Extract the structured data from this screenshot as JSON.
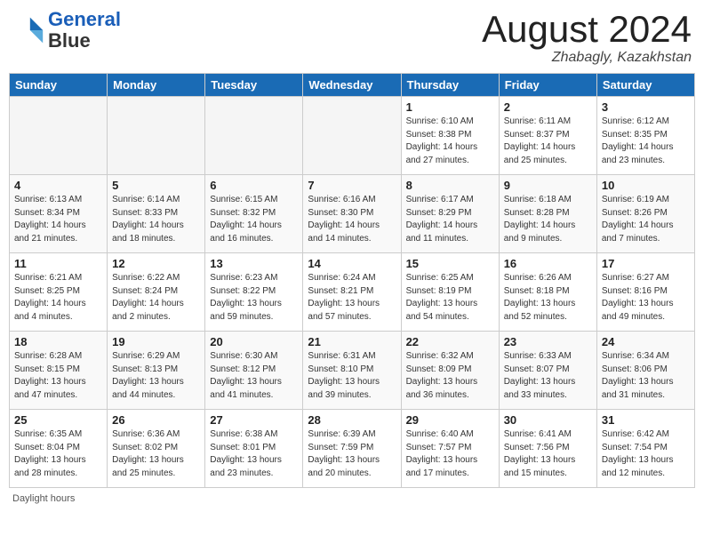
{
  "logo": {
    "line1": "General",
    "line2": "Blue"
  },
  "calendar": {
    "title": "August 2024",
    "subtitle": "Zhabagly, Kazakhstan"
  },
  "days_of_week": [
    "Sunday",
    "Monday",
    "Tuesday",
    "Wednesday",
    "Thursday",
    "Friday",
    "Saturday"
  ],
  "footer": "Daylight hours",
  "weeks": [
    [
      {
        "day": "",
        "info": ""
      },
      {
        "day": "",
        "info": ""
      },
      {
        "day": "",
        "info": ""
      },
      {
        "day": "",
        "info": ""
      },
      {
        "day": "1",
        "info": "Sunrise: 6:10 AM\nSunset: 8:38 PM\nDaylight: 14 hours\nand 27 minutes."
      },
      {
        "day": "2",
        "info": "Sunrise: 6:11 AM\nSunset: 8:37 PM\nDaylight: 14 hours\nand 25 minutes."
      },
      {
        "day": "3",
        "info": "Sunrise: 6:12 AM\nSunset: 8:35 PM\nDaylight: 14 hours\nand 23 minutes."
      }
    ],
    [
      {
        "day": "4",
        "info": "Sunrise: 6:13 AM\nSunset: 8:34 PM\nDaylight: 14 hours\nand 21 minutes."
      },
      {
        "day": "5",
        "info": "Sunrise: 6:14 AM\nSunset: 8:33 PM\nDaylight: 14 hours\nand 18 minutes."
      },
      {
        "day": "6",
        "info": "Sunrise: 6:15 AM\nSunset: 8:32 PM\nDaylight: 14 hours\nand 16 minutes."
      },
      {
        "day": "7",
        "info": "Sunrise: 6:16 AM\nSunset: 8:30 PM\nDaylight: 14 hours\nand 14 minutes."
      },
      {
        "day": "8",
        "info": "Sunrise: 6:17 AM\nSunset: 8:29 PM\nDaylight: 14 hours\nand 11 minutes."
      },
      {
        "day": "9",
        "info": "Sunrise: 6:18 AM\nSunset: 8:28 PM\nDaylight: 14 hours\nand 9 minutes."
      },
      {
        "day": "10",
        "info": "Sunrise: 6:19 AM\nSunset: 8:26 PM\nDaylight: 14 hours\nand 7 minutes."
      }
    ],
    [
      {
        "day": "11",
        "info": "Sunrise: 6:21 AM\nSunset: 8:25 PM\nDaylight: 14 hours\nand 4 minutes."
      },
      {
        "day": "12",
        "info": "Sunrise: 6:22 AM\nSunset: 8:24 PM\nDaylight: 14 hours\nand 2 minutes."
      },
      {
        "day": "13",
        "info": "Sunrise: 6:23 AM\nSunset: 8:22 PM\nDaylight: 13 hours\nand 59 minutes."
      },
      {
        "day": "14",
        "info": "Sunrise: 6:24 AM\nSunset: 8:21 PM\nDaylight: 13 hours\nand 57 minutes."
      },
      {
        "day": "15",
        "info": "Sunrise: 6:25 AM\nSunset: 8:19 PM\nDaylight: 13 hours\nand 54 minutes."
      },
      {
        "day": "16",
        "info": "Sunrise: 6:26 AM\nSunset: 8:18 PM\nDaylight: 13 hours\nand 52 minutes."
      },
      {
        "day": "17",
        "info": "Sunrise: 6:27 AM\nSunset: 8:16 PM\nDaylight: 13 hours\nand 49 minutes."
      }
    ],
    [
      {
        "day": "18",
        "info": "Sunrise: 6:28 AM\nSunset: 8:15 PM\nDaylight: 13 hours\nand 47 minutes."
      },
      {
        "day": "19",
        "info": "Sunrise: 6:29 AM\nSunset: 8:13 PM\nDaylight: 13 hours\nand 44 minutes."
      },
      {
        "day": "20",
        "info": "Sunrise: 6:30 AM\nSunset: 8:12 PM\nDaylight: 13 hours\nand 41 minutes."
      },
      {
        "day": "21",
        "info": "Sunrise: 6:31 AM\nSunset: 8:10 PM\nDaylight: 13 hours\nand 39 minutes."
      },
      {
        "day": "22",
        "info": "Sunrise: 6:32 AM\nSunset: 8:09 PM\nDaylight: 13 hours\nand 36 minutes."
      },
      {
        "day": "23",
        "info": "Sunrise: 6:33 AM\nSunset: 8:07 PM\nDaylight: 13 hours\nand 33 minutes."
      },
      {
        "day": "24",
        "info": "Sunrise: 6:34 AM\nSunset: 8:06 PM\nDaylight: 13 hours\nand 31 minutes."
      }
    ],
    [
      {
        "day": "25",
        "info": "Sunrise: 6:35 AM\nSunset: 8:04 PM\nDaylight: 13 hours\nand 28 minutes."
      },
      {
        "day": "26",
        "info": "Sunrise: 6:36 AM\nSunset: 8:02 PM\nDaylight: 13 hours\nand 25 minutes."
      },
      {
        "day": "27",
        "info": "Sunrise: 6:38 AM\nSunset: 8:01 PM\nDaylight: 13 hours\nand 23 minutes."
      },
      {
        "day": "28",
        "info": "Sunrise: 6:39 AM\nSunset: 7:59 PM\nDaylight: 13 hours\nand 20 minutes."
      },
      {
        "day": "29",
        "info": "Sunrise: 6:40 AM\nSunset: 7:57 PM\nDaylight: 13 hours\nand 17 minutes."
      },
      {
        "day": "30",
        "info": "Sunrise: 6:41 AM\nSunset: 7:56 PM\nDaylight: 13 hours\nand 15 minutes."
      },
      {
        "day": "31",
        "info": "Sunrise: 6:42 AM\nSunset: 7:54 PM\nDaylight: 13 hours\nand 12 minutes."
      }
    ]
  ]
}
